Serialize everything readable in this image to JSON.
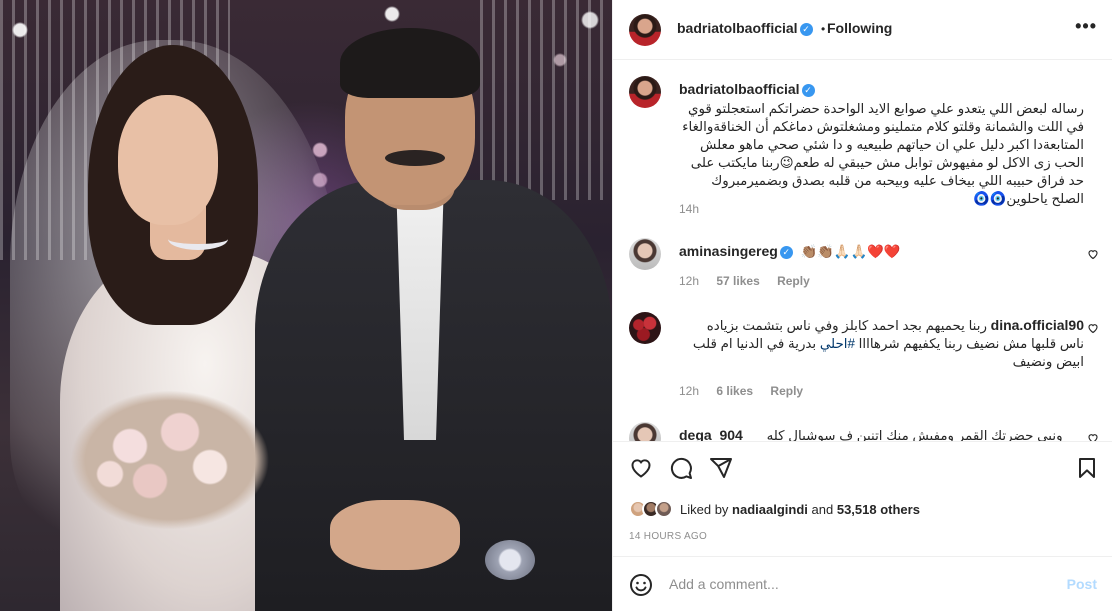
{
  "header": {
    "username": "badriatolbaofficial",
    "separator": "•",
    "follow_label": "Following",
    "more_label": "•••"
  },
  "caption": {
    "username": "badriatolbaofficial",
    "text": "رساله لبعض اللي يتعدو علي صوابع الايد الواحدة حضراتكم استعجلتو قوي في اللت والشمانة وقلتو كلام متملينو ومشغلتوش دماغكم أن الخناقةوالغاء المتابعةدا اكبر دليل علي ان حياتهم طبيعيه و دا شئي صحي ماهو معلش الحب زى الاكل لو مفيهوش توابل مش حيبقي له طعم😉ربنا مايكتب على حد فراق حبيبه اللي بيخاف عليه وبيحبه من قلبه بصدق وبضميرمبروك الصلح ياحلوين🧿🧿",
    "time": "14h"
  },
  "comments": [
    {
      "username": "aminasingereg",
      "verified": true,
      "text": "👏🏽👏🏽🙏🏻🙏🏻❤️❤️",
      "time": "12h",
      "likes": "57 likes",
      "reply": "Reply"
    },
    {
      "username": "dina.official90",
      "verified": false,
      "text_a": "ربنا يحميهم بجد احمد كابلز وفي ناس بتشمت بزياده ناس قلبها مش نضيف ربنا يكفيهم شرهاااا ",
      "hashtag": "#احلي",
      "text_b": " بدرية في الدنيا ام قلب ابيض ونضيف",
      "time": "12h",
      "likes": "6 likes",
      "reply": "Reply"
    },
    {
      "username": "dega_904",
      "verified": false,
      "text": "ونبي حضرتك القمر ومفيش منك اتنين ف سوشيال كله"
    }
  ],
  "actions": {
    "like_icon": "heart-icon",
    "comment_icon": "comment-icon",
    "share_icon": "paper-plane-icon",
    "save_icon": "bookmark-icon"
  },
  "likes": {
    "prefix": "Liked by",
    "user": "nadiaalgindi",
    "and": "and",
    "count": "53,518 others"
  },
  "time_ago": "14 HOURS AGO",
  "add_comment": {
    "placeholder": "Add a comment...",
    "post_label": "Post"
  },
  "colors": {
    "verified": "#3897f0",
    "post_disabled": "#b3dbff",
    "hashtag": "#00376b",
    "meta": "#8e8e8e"
  }
}
